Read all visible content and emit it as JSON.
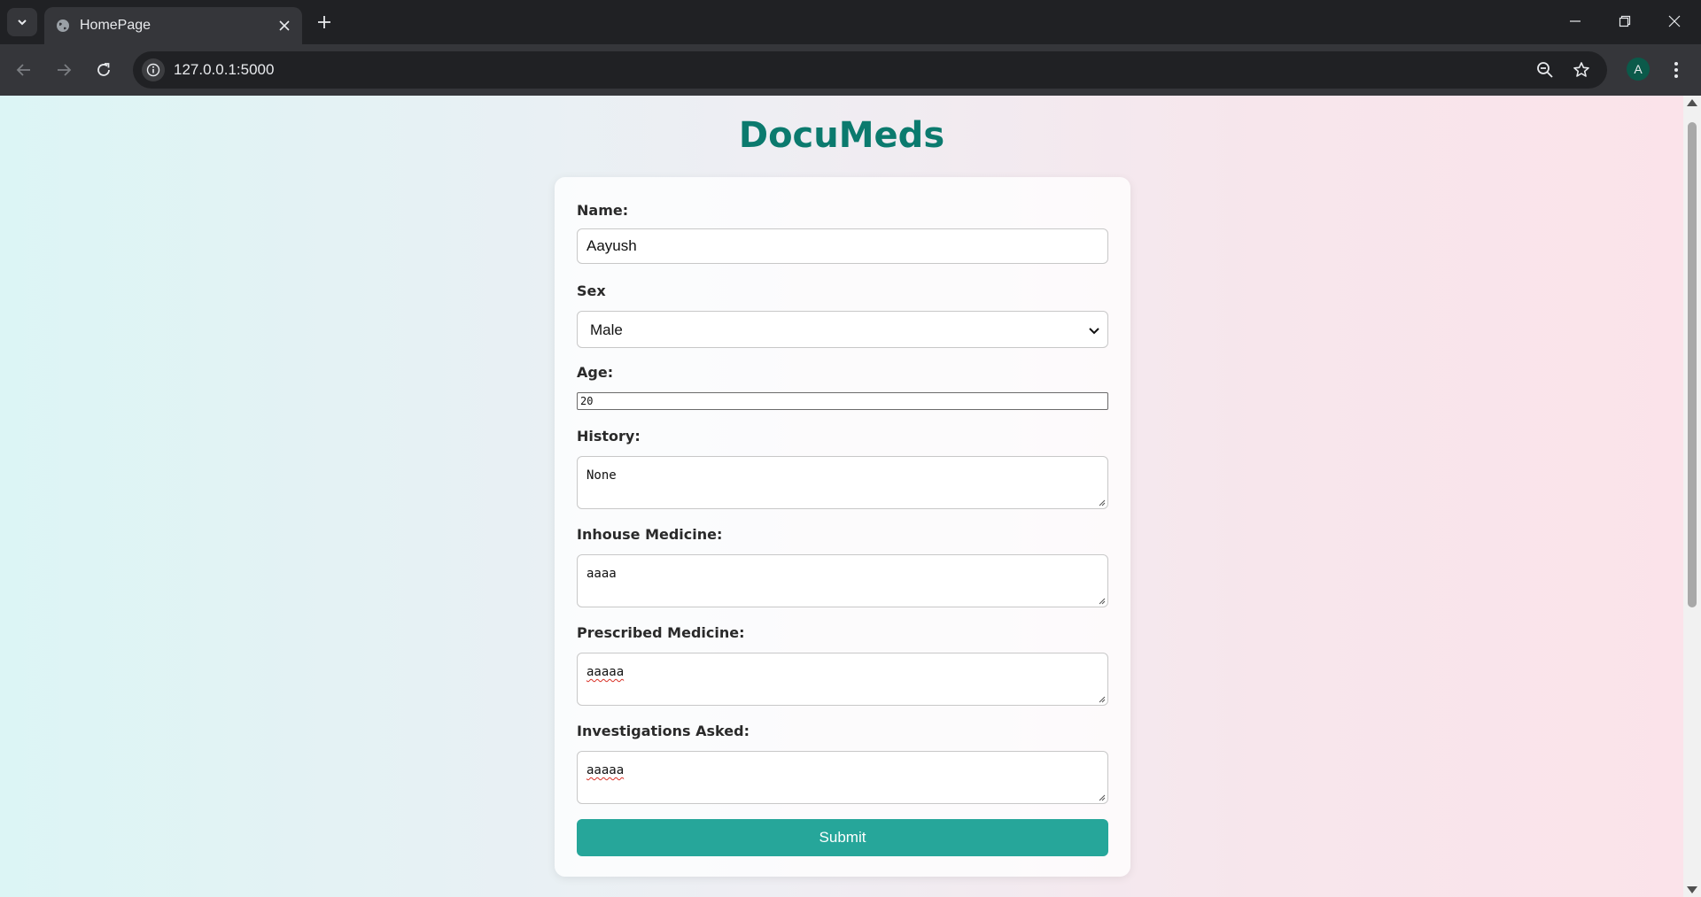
{
  "browser": {
    "tab": {
      "title": "HomePage",
      "favicon": "globe-icon"
    },
    "url": "127.0.0.1:5000",
    "profile_initial": "A",
    "colors": {
      "chrome_dark": "#202124",
      "chrome_tab": "#35363a",
      "avatar_bg": "#0b5a4a"
    }
  },
  "page": {
    "title": "DocuMeds",
    "colors": {
      "title": "#0b7a6e",
      "button": "#26a69a"
    }
  },
  "form": {
    "name": {
      "label": "Name:",
      "value": "Aayush"
    },
    "sex": {
      "label": "Sex",
      "selected": "Male"
    },
    "age": {
      "label": "Age:",
      "value": "20"
    },
    "history": {
      "label": "History:",
      "value": "None"
    },
    "inhouse_medicine": {
      "label": "Inhouse Medicine:",
      "value": "aaaa"
    },
    "prescribed_medicine": {
      "label": "Prescribed Medicine:",
      "value": "aaaaa"
    },
    "investigations": {
      "label": "Investigations Asked:",
      "value": "aaaaa"
    },
    "submit_label": "Submit"
  }
}
